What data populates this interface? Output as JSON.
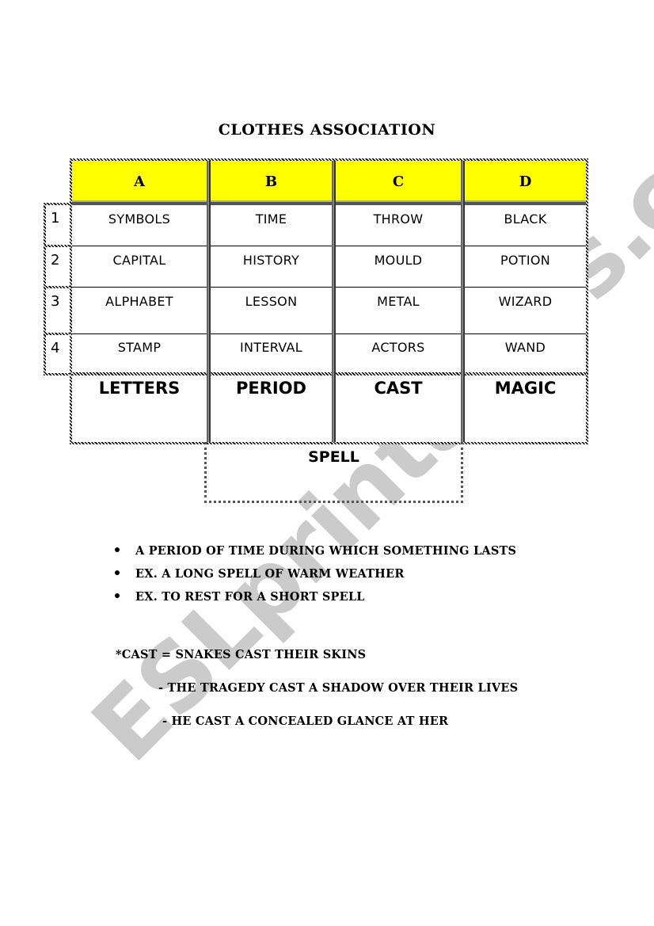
{
  "title": "CLOTHES ASSOCIATION",
  "table": {
    "columns": [
      {
        "header": "A",
        "words": [
          "SYMBOLS",
          "CAPITAL",
          "ALPHABET",
          "STAMP"
        ],
        "answer": "LETTERS"
      },
      {
        "header": "B",
        "words": [
          "TIME",
          "HISTORY",
          "LESSON",
          "INTERVAL"
        ],
        "answer": "PERIOD"
      },
      {
        "header": "C",
        "words": [
          "THROW",
          "MOULD",
          "METAL",
          "ACTORS"
        ],
        "answer": "CAST"
      },
      {
        "header": "D",
        "words": [
          "BLACK",
          "POTION",
          "WIZARD",
          "WAND"
        ],
        "answer": "MAGIC"
      }
    ],
    "row_numbers": [
      "1",
      "2",
      "3",
      "4"
    ],
    "final_answer": "SPELL"
  },
  "colors": {
    "header_fill": "#ffff00"
  },
  "notes": {
    "bullets": [
      "A PERIOD OF TIME DURING WHICH SOMETHING  LASTS",
      "EX. A LONG  SPELL OF WARM WEATHER",
      "EX. TO REST FOR A SHORT SPELL"
    ],
    "cast_lines": [
      "*CAST  = SNAKES CAST THEIR SKINS",
      "- THE TRAGEDY CAST  A SHADOW OVER THEIR LIVES",
      "- HE CAST  A CONCEALED GLANCE AT HER"
    ]
  },
  "watermark": "ESLprintables.com"
}
